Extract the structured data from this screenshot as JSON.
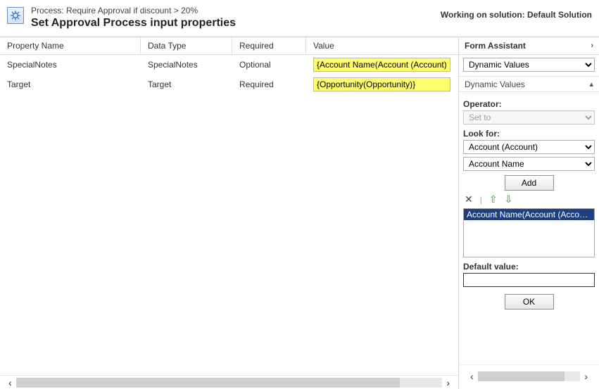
{
  "header": {
    "process_label": "Process: Require Approval if discount > 20%",
    "title": "Set Approval Process input properties",
    "working_on": "Working on solution: Default Solution"
  },
  "columns": {
    "name": "Property Name",
    "dtype": "Data Type",
    "required": "Required",
    "value": "Value"
  },
  "rows": [
    {
      "name": "SpecialNotes",
      "dtype": "SpecialNotes",
      "required": "Optional",
      "value": "{Account Name(Account (Account))}"
    },
    {
      "name": "Target",
      "dtype": "Target",
      "required": "Required",
      "value": "{Opportunity(Opportunity)}"
    }
  ],
  "assistant": {
    "title": "Form Assistant",
    "dynamic_values_option": "Dynamic Values",
    "subsection": "Dynamic Values",
    "operator_label": "Operator:",
    "operator_value": "Set to",
    "lookfor_label": "Look for:",
    "lookfor_entity": "Account (Account)",
    "lookfor_attr": "Account Name",
    "add_label": "Add",
    "selected_item": "Account Name(Account (Account))",
    "default_label": "Default value:",
    "default_value": "",
    "ok_label": "OK"
  }
}
